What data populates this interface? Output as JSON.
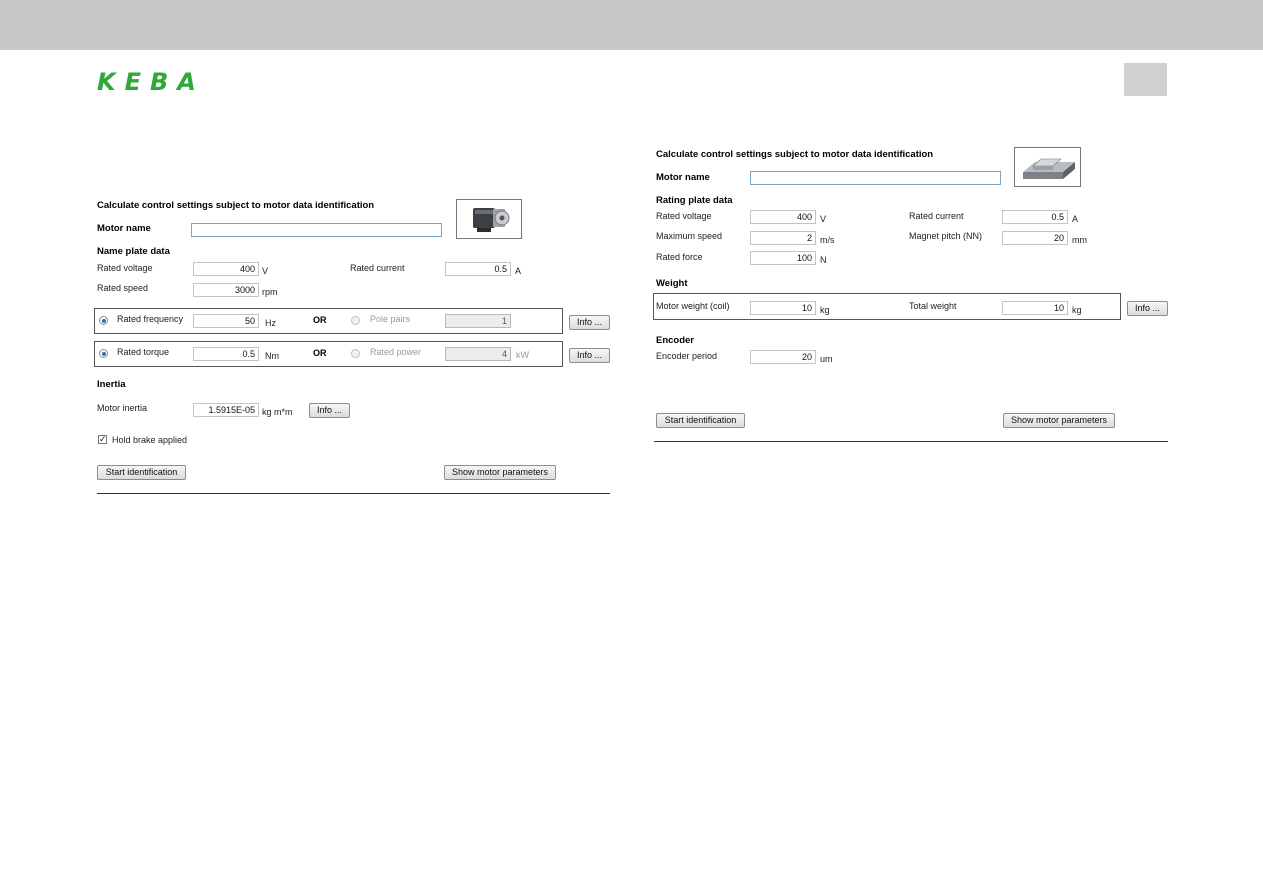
{
  "brand": {
    "logo_text": "KEBA",
    "logo_color": "#2ea836"
  },
  "left": {
    "title": "Calculate control settings subject to motor data identification",
    "motor_name": {
      "label": "Motor name",
      "value": "",
      "image_icon": "rotary-motor-icon"
    },
    "nameplate": {
      "header": "Name plate data",
      "rated_voltage": {
        "label": "Rated voltage",
        "value": "400",
        "unit": "V"
      },
      "rated_current": {
        "label": "Rated current",
        "value": "0.5",
        "unit": "A"
      },
      "rated_speed": {
        "label": "Rated speed",
        "value": "3000",
        "unit": "rpm"
      }
    },
    "freq_group": {
      "option_a": {
        "label": "Rated frequency",
        "value": "50",
        "unit": "Hz",
        "selected": true
      },
      "or": "OR",
      "option_b": {
        "label": "Pole pairs",
        "value": "1",
        "selected": false
      },
      "info": "Info ..."
    },
    "torque_group": {
      "option_a": {
        "label": "Rated torque",
        "value": "0.5",
        "unit": "Nm",
        "selected": true
      },
      "or": "OR",
      "option_b": {
        "label": "Rated power",
        "value": "4",
        "unit": "kW",
        "selected": false
      },
      "info": "Info ..."
    },
    "inertia": {
      "header": "Inertia",
      "motor_inertia": {
        "label": "Motor inertia",
        "value": "1.5915E-05",
        "unit": "kg m*m"
      },
      "info": "Info ..."
    },
    "hold_brake": {
      "label": "Hold brake applied",
      "checked": true
    },
    "buttons": {
      "start": "Start identification",
      "show": "Show motor parameters"
    }
  },
  "right": {
    "title": "Calculate control settings subject to motor data identification",
    "motor_name": {
      "label": "Motor name",
      "value": "",
      "image_icon": "linear-motor-icon"
    },
    "rating": {
      "header": "Rating plate data",
      "rated_voltage": {
        "label": "Rated voltage",
        "value": "400",
        "unit": "V"
      },
      "rated_current": {
        "label": "Rated current",
        "value": "0.5",
        "unit": "A"
      },
      "max_speed": {
        "label": "Maximum speed",
        "value": "2",
        "unit": "m/s"
      },
      "magnet_pitch": {
        "label": "Magnet pitch (NN)",
        "value": "20",
        "unit": "mm"
      },
      "rated_force": {
        "label": "Rated force",
        "value": "100",
        "unit": "N"
      }
    },
    "weight": {
      "header": "Weight",
      "motor_weight": {
        "label": "Motor weight (coil)",
        "value": "10",
        "unit": "kg"
      },
      "total_weight": {
        "label": "Total weight",
        "value": "10",
        "unit": "kg"
      },
      "info": "Info ..."
    },
    "encoder": {
      "header": "Encoder",
      "period": {
        "label": "Encoder period",
        "value": "20",
        "unit": "um"
      }
    },
    "buttons": {
      "start": "Start identification",
      "show": "Show motor parameters"
    }
  }
}
